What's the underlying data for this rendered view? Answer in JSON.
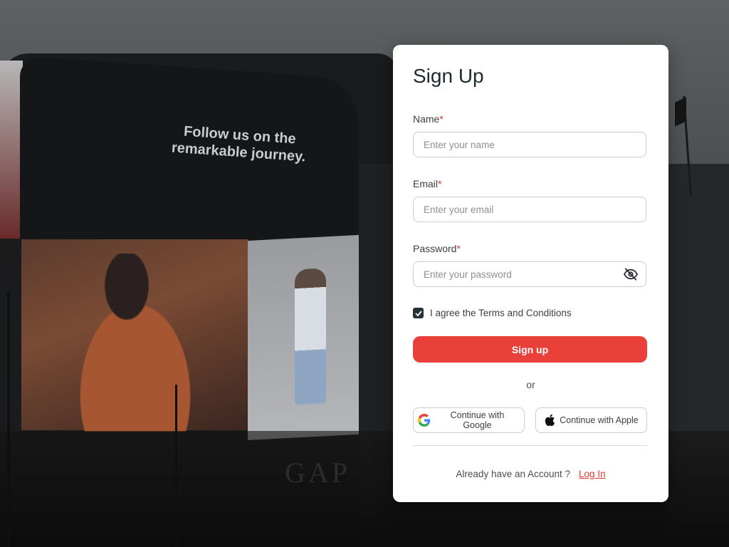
{
  "background": {
    "billboard_text": "Follow us on the remarkable journey.",
    "storefront_sign": "GAP"
  },
  "form": {
    "title": "Sign Up",
    "required_mark": "*",
    "name": {
      "label": "Name",
      "placeholder": "Enter your name",
      "value": ""
    },
    "email": {
      "label": "Email",
      "placeholder": "Enter your email",
      "value": ""
    },
    "password": {
      "label": "Password",
      "placeholder": "Enter your password",
      "value": "",
      "toggle_icon": "eye-slash-icon"
    },
    "terms": {
      "checked": true,
      "label": "I agree the Terms and Conditions"
    },
    "submit_label": "Sign up",
    "separator": "or",
    "google_label": "Continue with Google",
    "apple_label": "Continue with Apple",
    "footer_text": "Already have an Account ?",
    "login_link": "Log In"
  },
  "colors": {
    "accent": "#e9403a",
    "checkbox": "#263238",
    "title": "#1e2a2e"
  }
}
